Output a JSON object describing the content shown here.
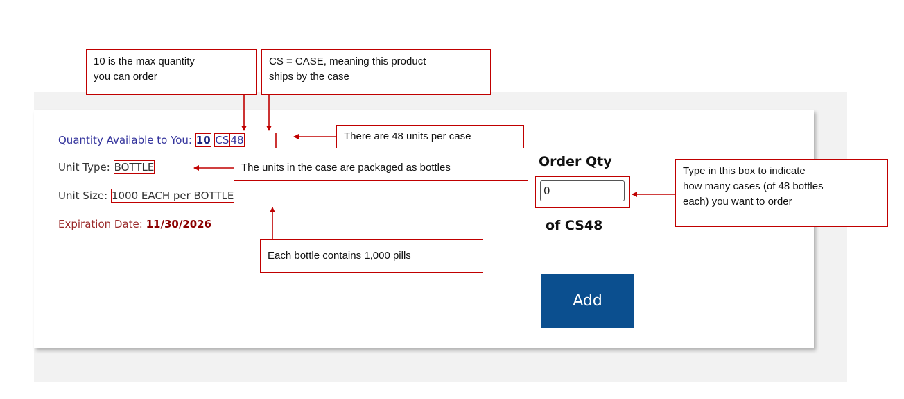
{
  "product": {
    "qty_label": "Quantity Available to You:",
    "qty_value": "10",
    "unit_code": "CS",
    "unit_count": "48",
    "unit_type_label": "Unit Type:",
    "unit_type_value": "BOTTLE",
    "unit_size_label": "Unit Size:",
    "unit_size_value": "1000 EACH per BOTTLE",
    "expiration_label": "Expiration Date:",
    "expiration_value": "11/30/2026"
  },
  "order": {
    "label": "Order Qty",
    "input_value": "0",
    "of_label": "of CS48",
    "add_label": "Add"
  },
  "callouts": {
    "max_qty_line1": "10 is the max quantity",
    "max_qty_line2": "you can order",
    "case_line1": "CS = CASE, meaning this product",
    "case_line2": "ships by the case",
    "units_per_case": "There are 48 units per case",
    "packaged": "The units in the case are packaged as bottles",
    "type_line1": "Type in this box to indicate",
    "type_line2": "how many cases (of 48 bottles",
    "type_line3": "each) you want to order",
    "pills": "Each bottle contains 1,000 pills"
  },
  "colors": {
    "accent_red": "#c00000",
    "button_blue": "#0b4f8f",
    "qty_blue": "#33339c",
    "expiration_red": "#9a2a2a"
  }
}
